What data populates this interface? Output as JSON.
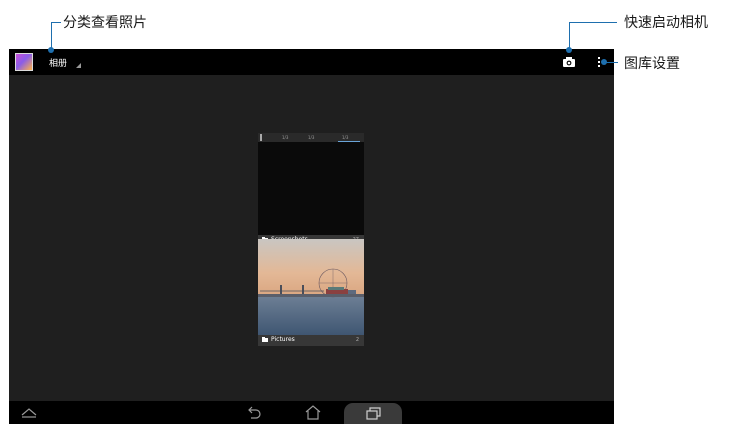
{
  "callouts": {
    "sort_photos": "分类查看照片",
    "quick_camera": "快速启动相机",
    "gallery_settings": "图库设置"
  },
  "actionbar": {
    "album_label": "相册",
    "app_icon": "gallery-app-icon",
    "camera_icon": "camera-icon",
    "overflow_icon": "overflow-menu-icon"
  },
  "albums": [
    {
      "name": "Screenshots",
      "count": "27"
    },
    {
      "name": "Pictures",
      "count": "2"
    }
  ],
  "screenshot_thumb": {
    "tabs": [
      "1/3",
      "1/3",
      "1/3"
    ]
  },
  "navbar": {
    "hide_icon": "hide-bar-icon",
    "back_icon": "back-icon",
    "home_icon": "home-icon",
    "recents_icon": "recent-apps-icon"
  },
  "colors": {
    "accent": "#1e6fae",
    "screen_bg": "#1f1f1f",
    "bar_bg": "#000000"
  }
}
